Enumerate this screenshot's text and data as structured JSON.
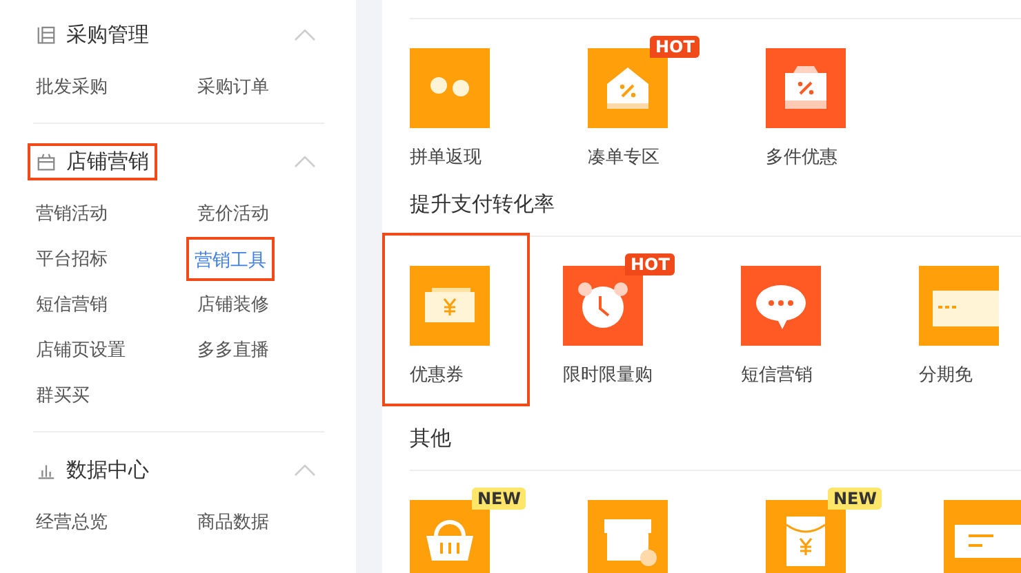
{
  "sidebar": {
    "sections": [
      {
        "kind": "grid",
        "title": "采购管理",
        "expanded": true,
        "highlighted": false,
        "items": [
          {
            "label": "批发采购",
            "selected": false,
            "highlighted": false
          },
          {
            "label": "采购订单",
            "selected": false,
            "highlighted": false
          }
        ]
      },
      {
        "kind": "shop",
        "title": "店铺营销",
        "expanded": true,
        "highlighted": true,
        "items": [
          {
            "label": "营销活动",
            "selected": false,
            "highlighted": false
          },
          {
            "label": "竞价活动",
            "selected": false,
            "highlighted": false
          },
          {
            "label": "平台招标",
            "selected": false,
            "highlighted": false
          },
          {
            "label": "营销工具",
            "selected": true,
            "highlighted": true
          },
          {
            "label": "短信营销",
            "selected": false,
            "highlighted": false
          },
          {
            "label": "店铺装修",
            "selected": false,
            "highlighted": false
          },
          {
            "label": "店铺页设置",
            "selected": false,
            "highlighted": false
          },
          {
            "label": "多多直播",
            "selected": false,
            "highlighted": false
          },
          {
            "label": "群买买",
            "selected": false,
            "highlighted": false
          }
        ]
      },
      {
        "kind": "chart",
        "title": "数据中心",
        "expanded": true,
        "highlighted": false,
        "items": [
          {
            "label": "经营总览",
            "selected": false,
            "highlighted": false
          },
          {
            "label": "商品数据",
            "selected": false,
            "highlighted": false
          }
        ]
      }
    ]
  },
  "main": {
    "groups": [
      {
        "tiles": [
          {
            "kind": "coins",
            "label": "拼单返现",
            "highlighted": false
          },
          {
            "kind": "house",
            "label": "凑单专区",
            "badge": {
              "kind": "hot",
              "text": "HOT"
            },
            "highlighted": false
          },
          {
            "kind": "bag",
            "label": "多件优惠",
            "highlighted": false
          }
        ]
      },
      {
        "title": "提升支付转化率",
        "tiles": [
          {
            "kind": "ticket",
            "label": "优惠券",
            "highlighted": true
          },
          {
            "kind": "clock",
            "label": "限时限量购",
            "badge": {
              "kind": "hot",
              "text": "HOT"
            },
            "highlighted": false
          },
          {
            "kind": "chat",
            "label": "短信营销",
            "highlighted": false
          },
          {
            "kind": "card",
            "label": "分期免",
            "highlighted": false
          }
        ]
      },
      {
        "title": "其他",
        "tiles": [
          {
            "kind": "basket",
            "badge": {
              "kind": "new",
              "text": "NEW"
            },
            "highlighted": false
          },
          {
            "kind": "store",
            "highlighted": false
          },
          {
            "kind": "envelope",
            "badge": {
              "kind": "new",
              "text": "NEW"
            },
            "highlighted": false
          },
          {
            "kind": "message",
            "highlighted": false
          }
        ]
      }
    ]
  }
}
